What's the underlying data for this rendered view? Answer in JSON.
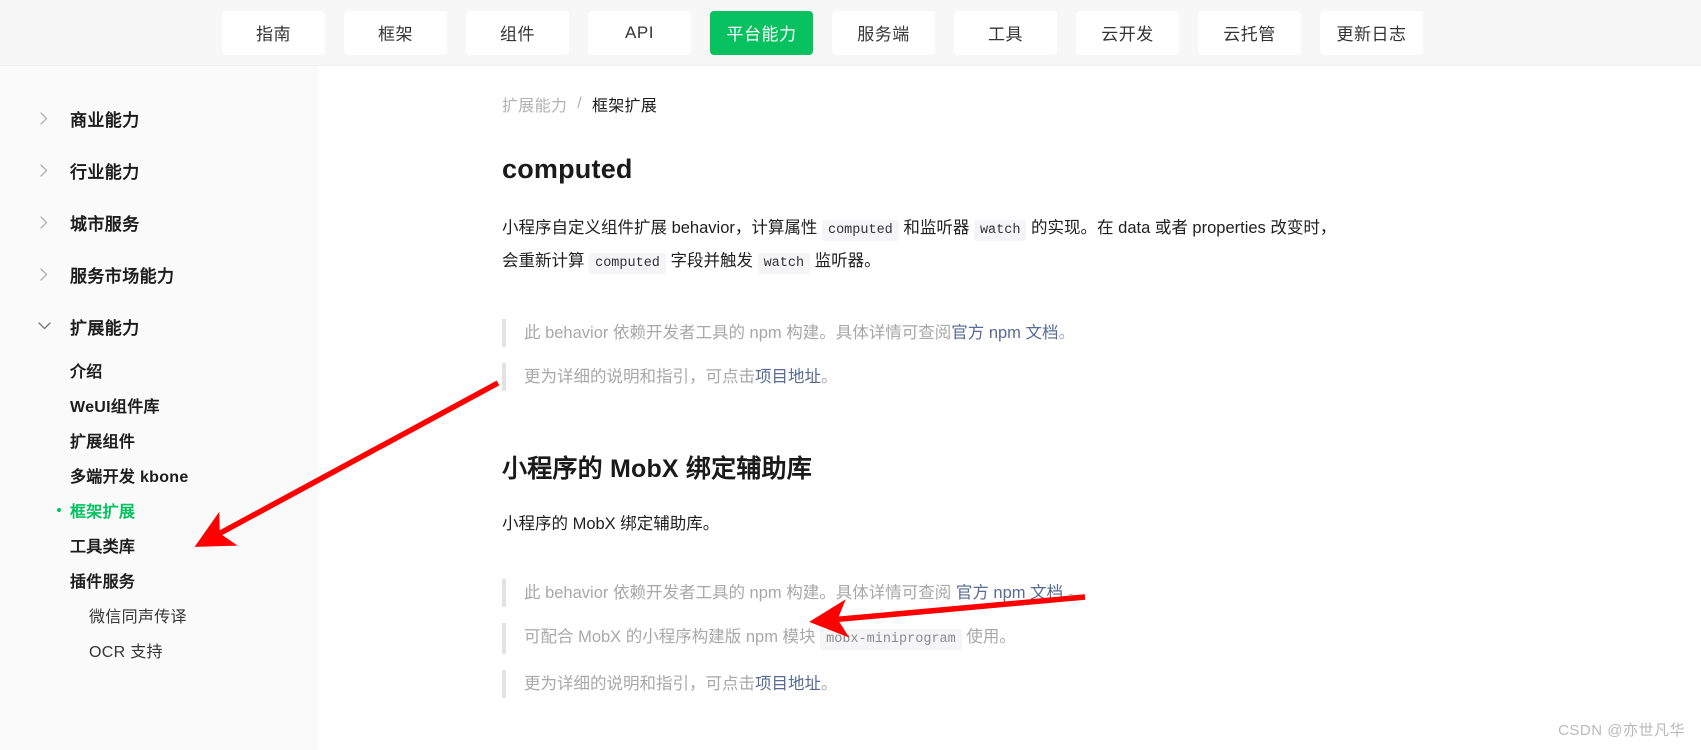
{
  "topnav": {
    "items": [
      {
        "label": "指南",
        "active": false
      },
      {
        "label": "框架",
        "active": false
      },
      {
        "label": "组件",
        "active": false
      },
      {
        "label": "API",
        "active": false
      },
      {
        "label": "平台能力",
        "active": true
      },
      {
        "label": "服务端",
        "active": false
      },
      {
        "label": "工具",
        "active": false
      },
      {
        "label": "云开发",
        "active": false
      },
      {
        "label": "云托管",
        "active": false
      },
      {
        "label": "更新日志",
        "active": false
      }
    ],
    "active_color": "#07c160"
  },
  "sidebar": {
    "groups": [
      {
        "label": "商业能力",
        "expanded": false,
        "icon": "chevron-right-icon"
      },
      {
        "label": "行业能力",
        "expanded": false,
        "icon": "chevron-right-icon"
      },
      {
        "label": "城市服务",
        "expanded": false,
        "icon": "chevron-right-icon"
      },
      {
        "label": "服务市场能力",
        "expanded": false,
        "icon": "chevron-right-icon"
      },
      {
        "label": "扩展能力",
        "expanded": true,
        "icon": "chevron-down-icon"
      }
    ],
    "items": [
      {
        "label": "介绍",
        "level": 1,
        "active": false
      },
      {
        "label": "WeUI组件库",
        "level": 1,
        "active": false
      },
      {
        "label": "扩展组件",
        "level": 1,
        "active": false
      },
      {
        "label": "多端开发 kbone",
        "level": 1,
        "active": false
      },
      {
        "label": "框架扩展",
        "level": 1,
        "active": true
      },
      {
        "label": "工具类库",
        "level": 1,
        "active": false
      },
      {
        "label": "插件服务",
        "level": 1,
        "active": false
      },
      {
        "label": "微信同声传译",
        "level": 2,
        "active": false
      },
      {
        "label": "OCR 支持",
        "level": 2,
        "active": false
      }
    ],
    "active_color": "#07c160"
  },
  "breadcrumb": {
    "parent": "扩展能力",
    "separator": "/",
    "current": "框架扩展"
  },
  "content": {
    "section1": {
      "title": "computed",
      "paragraph": {
        "p1": "小程序自定义组件扩展 behavior，计算属性 ",
        "code1": "computed",
        "p2": " 和监听器 ",
        "code2": "watch",
        "p3": " 的实现。在 data 或者 properties 改变时，会重新计算 ",
        "code3": "computed",
        "p4": " 字段并触发 ",
        "code4": "watch",
        "p5": " 监听器。"
      },
      "quote1": {
        "before": "此 behavior 依赖开发者工具的 npm 构建。具体详情可查阅",
        "link": "官方 npm 文档",
        "after": "。"
      },
      "quote2": {
        "before": "更为详细的说明和指引，可点击",
        "link": "项目地址",
        "after": "。"
      }
    },
    "section2": {
      "title": "小程序的 MobX 绑定辅助库",
      "paragraph": "小程序的 MobX 绑定辅助库。",
      "quote1": {
        "before": "此 behavior 依赖开发者工具的 npm 构建。具体详情可查阅 ",
        "link": "官方 npm 文档",
        "after": " 。"
      },
      "quote2": {
        "before": "可配合 MobX 的小程序构建版 npm 模块 ",
        "code": "mobx-miniprogram",
        "after": " 使用。"
      },
      "quote3": {
        "before": "更为详细的说明和指引，可点击",
        "link": "项目地址",
        "after": "。"
      }
    }
  },
  "annotations": {
    "arrow_color": "#ff0000",
    "arrow1_target": "框架扩展",
    "arrow2_target": "项目地址"
  },
  "watermark": "CSDN @亦世凡华"
}
